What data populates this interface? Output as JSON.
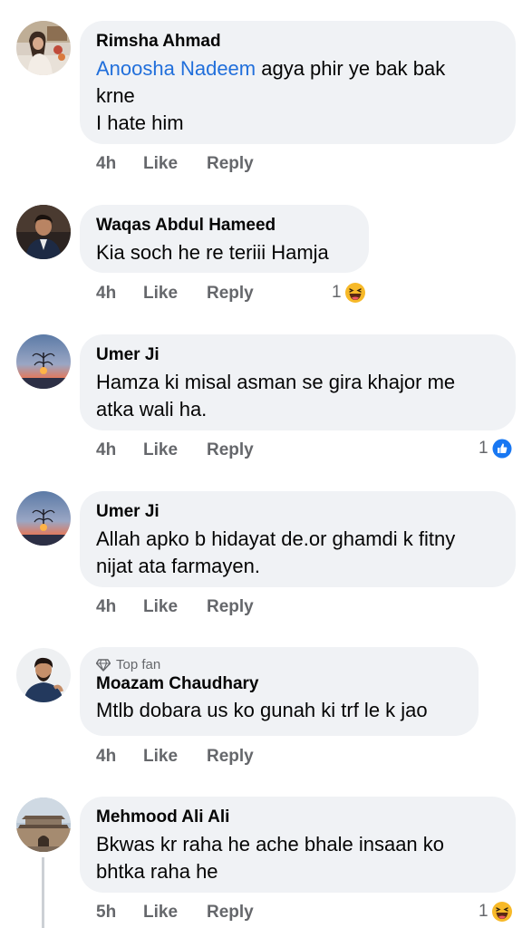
{
  "comments": [
    {
      "author": "Rimsha Ahmad",
      "mention": "Anoosha Nadeem",
      "text_line1": " agya phir ye bak bak",
      "text_line2": "krne",
      "text_line3": "I hate him",
      "time": "4h",
      "like": "Like",
      "reply": "Reply"
    },
    {
      "author": "Waqas Abdul Hameed",
      "text": "Kia soch he re teriii Hamja",
      "time": "4h",
      "like": "Like",
      "reply": "Reply",
      "reaction_count": "1",
      "reaction": "haha-icon"
    },
    {
      "author": "Umer Ji",
      "text_line1": "Hamza ki misal asman se gira khajor me",
      "text_line2": "atka wali ha.",
      "time": "4h",
      "like": "Like",
      "reply": "Reply",
      "reaction_count": "1",
      "reaction": "like-icon"
    },
    {
      "author": "Umer Ji",
      "text_line1": "Allah apko b hidayat de.or ghamdi k fitny",
      "text_line2": "nijat ata farmayen.",
      "time": "4h",
      "like": "Like",
      "reply": "Reply"
    },
    {
      "badge": "Top fan",
      "badge_icon": "diamond-icon",
      "author": "Moazam Chaudhary",
      "text": "Mtlb dobara us ko gunah ki trf le k jao",
      "time": "4h",
      "like": "Like",
      "reply": "Reply"
    },
    {
      "author": "Mehmood Ali Ali",
      "text_line1": "Bkwas kr raha he ache bhale insaan ko",
      "text_line2": "bhtka raha he",
      "time": "5h",
      "like": "Like",
      "reply": "Reply",
      "reaction_count": "1",
      "reaction": "haha-icon"
    }
  ],
  "colors": {
    "bubble": "#f0f2f5",
    "meta_text": "#65676b",
    "mention": "#216fdb",
    "like_blue": "#1877f2",
    "haha_yellow": "#f7b928"
  }
}
